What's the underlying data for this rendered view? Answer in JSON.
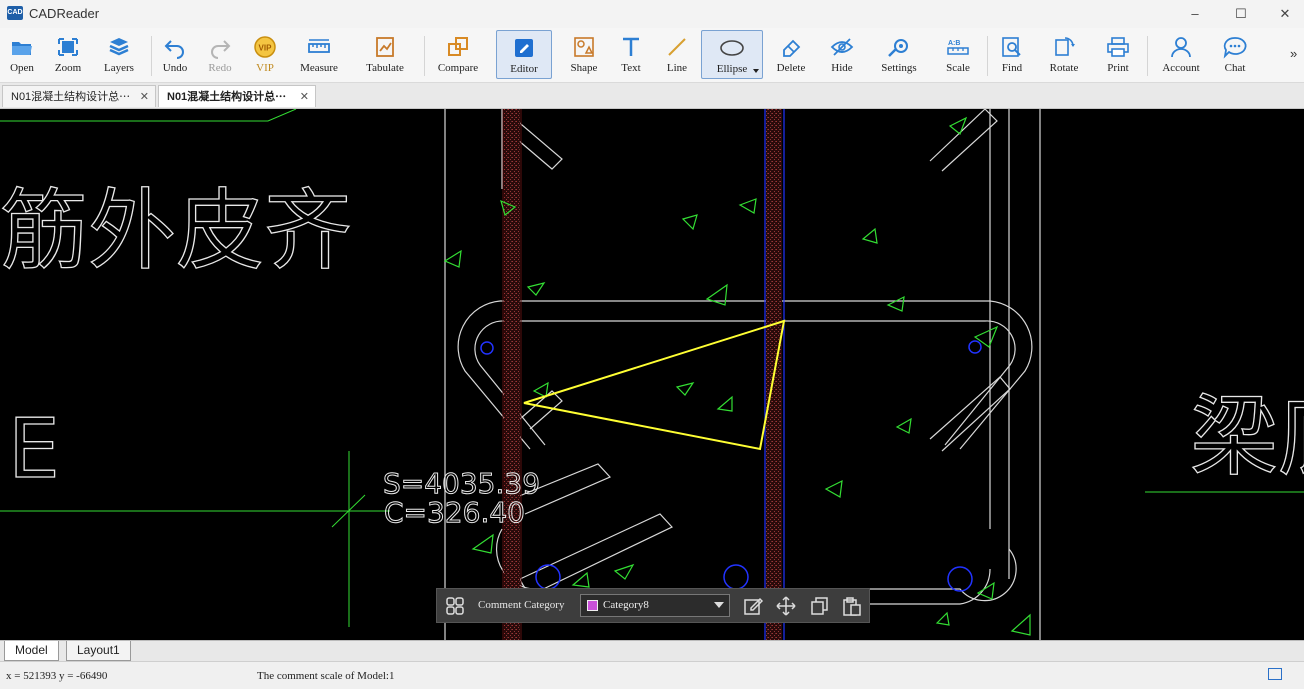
{
  "app": {
    "title": "CADReader",
    "logo_text": "CAD"
  },
  "window_controls": {
    "minimize": "–",
    "maximize": "☐",
    "close": "✕"
  },
  "toolbar": {
    "open": "Open",
    "zoom": "Zoom",
    "layers": "Layers",
    "undo": "Undo",
    "redo": "Redo",
    "vip": "VIP",
    "measure": "Measure",
    "tabulate": "Tabulate",
    "compare": "Compare",
    "editor": "Editor",
    "shape": "Shape",
    "text": "Text",
    "line": "Line",
    "ellipse": "Ellipse",
    "delete": "Delete",
    "hide": "Hide",
    "settings": "Settings",
    "scale": "Scale",
    "find": "Find",
    "rotate": "Rotate",
    "print": "Print",
    "account": "Account",
    "chat": "Chat",
    "more": "»"
  },
  "tabs": [
    {
      "label": "N01混凝土结构设计总⋯",
      "close": "✕"
    },
    {
      "label": "N01混凝土结构设计总⋯",
      "close": "✕"
    }
  ],
  "drawing": {
    "text_left_top": "筋外皮齐",
    "text_left_mid": "E",
    "measure_s": "S=4035.39",
    "measure_c": "C=326.40",
    "text_right": "梁底"
  },
  "comment_bar": {
    "label": "Comment Category",
    "category": "Category8",
    "category_color": "#c850d8"
  },
  "layout_tabs": [
    "Model",
    "Layout1"
  ],
  "status": {
    "coords": "x = 521393  y = -66490",
    "note": "The comment scale of Model:1"
  },
  "colors": {
    "highlight_yellow": "#ffff33",
    "cad_green": "#33dd33",
    "cad_white": "#e8e8e8",
    "cad_blue": "#2233ff"
  }
}
